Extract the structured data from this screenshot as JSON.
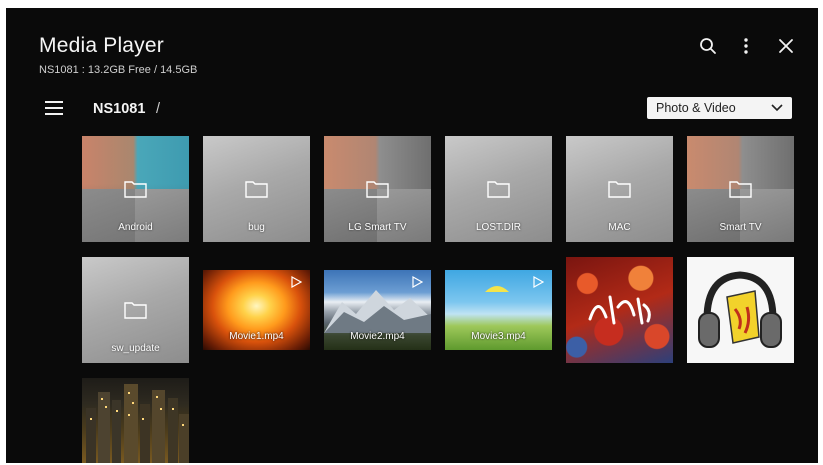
{
  "app": {
    "title": "Media Player",
    "storage": "NS1081 : 13.2GB Free / 14.5GB"
  },
  "toolbar": {
    "icons": [
      "search-icon",
      "more-vertical-icon",
      "close-icon"
    ]
  },
  "nav": {
    "breadcrumb": "NS1081",
    "separator": "/"
  },
  "filter": {
    "selected": "Photo & Video"
  },
  "items": [
    {
      "label": "Android",
      "kind": "folder"
    },
    {
      "label": "bug",
      "kind": "folder"
    },
    {
      "label": "LG Smart TV",
      "kind": "folder"
    },
    {
      "label": "LOST.DIR",
      "kind": "folder"
    },
    {
      "label": "MAC",
      "kind": "folder"
    },
    {
      "label": "Smart TV",
      "kind": "folder"
    },
    {
      "label": "sw_update",
      "kind": "folder"
    },
    {
      "label": "Movie1.mp4",
      "kind": "video"
    },
    {
      "label": "Movie2.mp4",
      "kind": "video"
    },
    {
      "label": "Movie3.mp4",
      "kind": "video"
    },
    {
      "label": "",
      "kind": "photo"
    },
    {
      "label": "",
      "kind": "photo"
    },
    {
      "label": "",
      "kind": "photo"
    }
  ],
  "colors": {
    "background": "#0a0a0a",
    "text": "#f5f5f5",
    "filter_bg": "#f4f4f4"
  }
}
